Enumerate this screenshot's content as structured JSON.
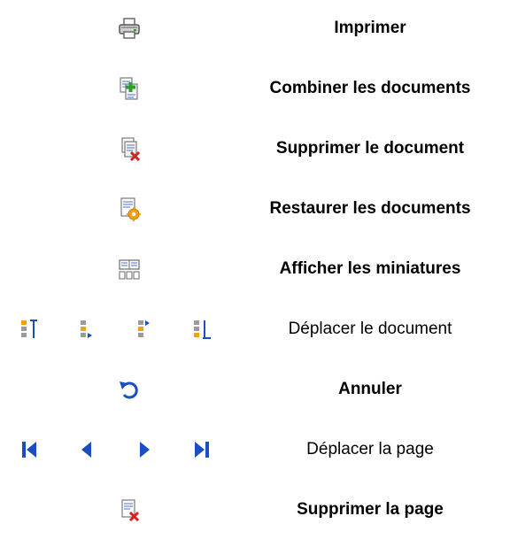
{
  "rows": [
    {
      "label": "Imprimer",
      "icon": "printer-icon"
    },
    {
      "label": "Combiner les documents",
      "icon": "combine-documents-icon"
    },
    {
      "label": "Supprimer le document",
      "icon": "delete-document-icon"
    },
    {
      "label": "Restaurer les documents",
      "icon": "restore-documents-icon"
    },
    {
      "label": "Afficher les miniatures",
      "icon": "thumbnails-icon"
    },
    {
      "label": "Déplacer le document",
      "icons": [
        "move-to-top-icon",
        "move-up-icon",
        "move-down-icon",
        "move-to-bottom-icon"
      ]
    },
    {
      "label": "Annuler",
      "icon": "undo-icon"
    },
    {
      "label": "Déplacer la page",
      "icons": [
        "first-page-icon",
        "previous-page-icon",
        "next-page-icon",
        "last-page-icon"
      ]
    },
    {
      "label": "Supprimer la page",
      "icon": "delete-page-icon"
    }
  ],
  "colors": {
    "accent_blue": "#1a4ec2",
    "delete_red": "#d42020",
    "add_green": "#2aa02a",
    "restore_orange": "#f2a20c",
    "icon_gray": "#8a8a8a"
  }
}
